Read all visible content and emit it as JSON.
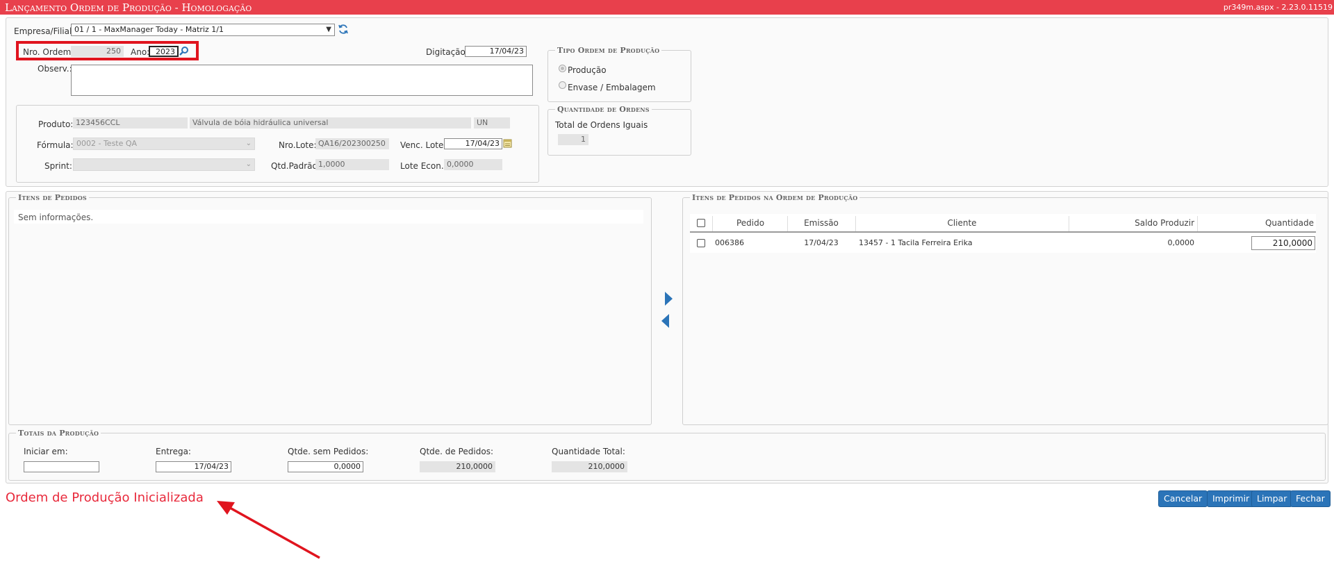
{
  "header": {
    "title": "Lançamento Ordem de Produção  - Homologação",
    "version": "pr349m.aspx - 2.23.0.11519"
  },
  "form": {
    "empresa_label": "Empresa/Filial:",
    "empresa_value": "01 / 1 - MaxManager Today - Matriz 1/1",
    "nro_ordem_label": "Nro. Ordem:",
    "nro_ordem_value": "250",
    "ano_label": "Ano:",
    "ano_value": "2023",
    "digitacao_label": "Digitação:",
    "digitacao_value": "17/04/23",
    "observ_label": "Observ.:",
    "observ_value": ""
  },
  "produto": {
    "produto_label": "Produto:",
    "produto_code": "123456CCL",
    "produto_desc": "Válvula de bóia hidráulica universal",
    "produto_unit": "UN",
    "formula_label": "Fórmula:",
    "formula_value": "0002 - Teste QA",
    "nro_lote_label": "Nro.Lote:",
    "nro_lote_value": "QA16/202300250",
    "venc_lote_label": "Venc. Lote:",
    "venc_lote_value": "17/04/23",
    "sprint_label": "Sprint:",
    "sprint_value": "",
    "qtd_padrao_label": "Qtd.Padrão:",
    "qtd_padrao_value": "1,0000",
    "lote_econ_label": "Lote Econ.:",
    "lote_econ_value": "0,0000"
  },
  "tipo_ordem": {
    "legend": "Tipo Ordem de Produção",
    "options": [
      {
        "label": "Produção",
        "selected": true
      },
      {
        "label": "Envase / Embalagem",
        "selected": false
      }
    ]
  },
  "quantidade_ordens": {
    "legend": "Quantidade de Ordens",
    "label": "Total de Ordens Iguais",
    "value": "1"
  },
  "itens_pedidos": {
    "legend": "Itens de Pedidos",
    "empty_text": "Sem informações."
  },
  "itens_ordem": {
    "legend": "Itens de Pedidos na Ordem de Produção",
    "columns": [
      "Pedido",
      "Emissão",
      "Cliente",
      "Saldo Produzir",
      "Quantidade"
    ],
    "rows": [
      {
        "pedido": "006386",
        "emissao": "17/04/23",
        "cliente": "13457 - 1 Tacila Ferreira Erika",
        "saldo": "0,0000",
        "quantidade": "210,0000"
      }
    ]
  },
  "totais": {
    "legend": "Totais da Produção",
    "iniciar_label": "Iniciar em:",
    "iniciar_value": "",
    "entrega_label": "Entrega:",
    "entrega_value": "17/04/23",
    "qtde_sem_label": "Qtde. sem Pedidos:",
    "qtde_sem_value": "0,0000",
    "qtde_ped_label": "Qtde. de Pedidos:",
    "qtde_ped_value": "210,0000",
    "qtde_total_label": "Quantidade Total:",
    "qtde_total_value": "210,0000"
  },
  "status_message": "Ordem de Produção Inicializada",
  "buttons": {
    "cancelar": "Cancelar",
    "imprimir": "Imprimir",
    "limpar": "Limpar",
    "fechar": "Fechar"
  },
  "colors": {
    "title_bar": "#e8404c",
    "button": "#2b74b8",
    "status_text": "#e8293b",
    "highlight_box": "#e0141e",
    "arrow": "#e0141e"
  },
  "icons": {
    "refresh": "refresh-icon",
    "search": "magnifier-icon",
    "calendar": "calendar-icon",
    "move_right": "triangle-right-icon",
    "move_left": "triangle-left-icon"
  }
}
